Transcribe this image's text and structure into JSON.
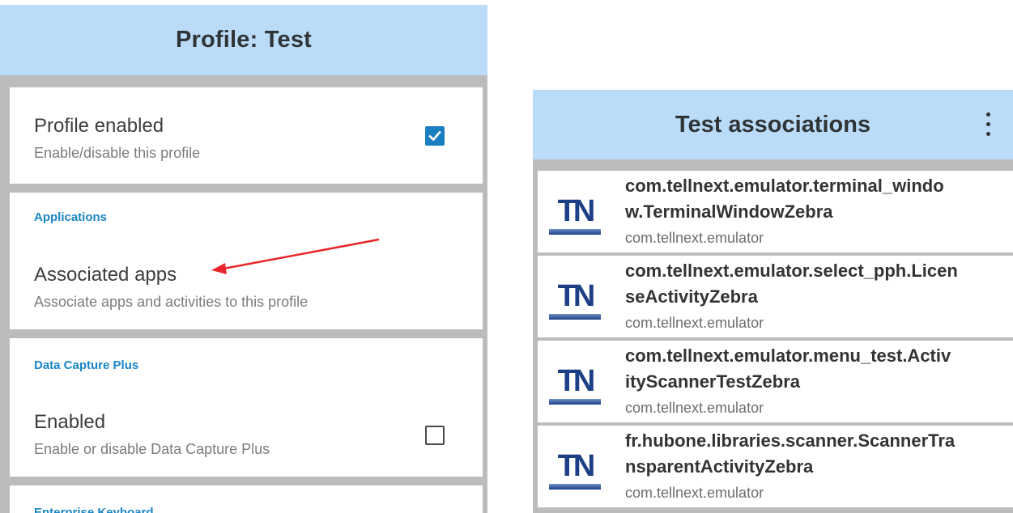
{
  "profile_screen": {
    "header_title": "Profile: Test",
    "profile_enabled": {
      "title": "Profile enabled",
      "subtitle": "Enable/disable this profile",
      "checked": true
    },
    "applications": {
      "category": "Applications",
      "title": "Associated apps",
      "subtitle": "Associate apps and activities to this profile"
    },
    "data_capture_plus": {
      "category": "Data Capture Plus",
      "title": "Enabled",
      "subtitle": "Enable or disable Data Capture Plus",
      "checked": false
    },
    "enterprise_keyboard": {
      "category": "Enterprise Keyboard"
    },
    "annotation": {
      "arrow_color": "#e8262b"
    }
  },
  "associations_screen": {
    "header_title": "Test associations",
    "menu_icon": "more-vertical-icon",
    "items": [
      {
        "title_line1": "com.tellnext.emulator.terminal_windo",
        "title_line2": "w.TerminalWindowZebra",
        "package": "com.tellnext.emulator",
        "icon": "tn-logo-icon"
      },
      {
        "title_line1": "com.tellnext.emulator.select_pph.Licen",
        "title_line2": "seActivityZebra",
        "package": "com.tellnext.emulator",
        "icon": "tn-logo-icon"
      },
      {
        "title_line1": "com.tellnext.emulator.menu_test.Activ",
        "title_line2": "ityScannerTestZebra",
        "package": "com.tellnext.emulator",
        "icon": "tn-logo-icon"
      },
      {
        "title_line1": "fr.hubone.libraries.scanner.ScannerTra",
        "title_line2": "nsparentActivityZebra",
        "package": "com.tellnext.emulator",
        "icon": "tn-logo-icon"
      }
    ]
  },
  "colors": {
    "header_bg": "#bbdcf8",
    "separator_bg": "#bcbcbc",
    "category_text": "#1a85c5",
    "checkbox_checked": "#1a7fc1",
    "logo_blue": "#1c3f86"
  }
}
